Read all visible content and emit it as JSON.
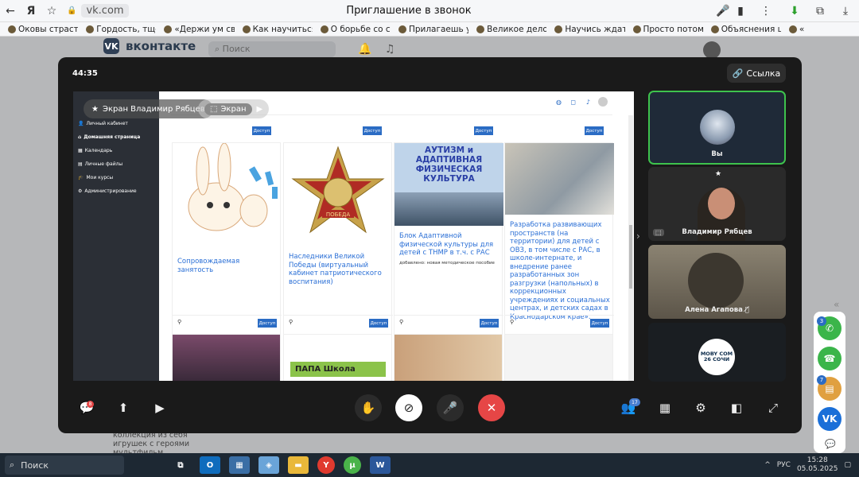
{
  "browser": {
    "url": "vk.com",
    "page_title": "Приглашение в звонок",
    "bookmarks": [
      "Оковы страстей и",
      "Гордость, тщесла",
      "«Держи ум свой",
      "Как научиться до",
      "О борьбе со стра",
      "Прилагаешь усил",
      "Великое дело — у",
      "Научись ждать / I",
      "Просто потому, ч",
      "Объяснения церк",
      "«"
    ]
  },
  "vk": {
    "logo_text": "вконтакте",
    "search_placeholder": "Поиск",
    "bottom_text": "коллекция из себя игрушек с героями мультфильм"
  },
  "call": {
    "timer": "44:35",
    "link_label": "Ссылка",
    "screen_owner_label": "Экран Владимир Рябцев",
    "screen_label": "Экран",
    "participants": [
      {
        "name": "Вы"
      },
      {
        "name": "Владимир Рябцев"
      },
      {
        "name": "Алена Агапова"
      },
      {
        "name": "MOBY COM 26 СОЧИ"
      }
    ],
    "chat_badge": "8",
    "participants_badge": "17"
  },
  "shared_screen": {
    "sidebar": [
      "Личный кабинет",
      "Домашняя страница",
      "Календарь",
      "Личные файлы",
      "Мои курсы",
      "Администрирование"
    ],
    "doc_label": "Доступ",
    "cards": [
      {
        "title": "Сопровождаемая занятость"
      },
      {
        "title": "Наследники Великой Победы (виртуальный кабинет патриотического воспитания)"
      },
      {
        "title": "Блок Адаптивной физической культуры для детей с ТНМР в т.ч. с РАС",
        "image_heading": "АУТИЗМ и АДАПТИВНАЯ ФИЗИЧЕСКАЯ КУЛЬТУРА",
        "note": "добавлено: новая методическое пособие"
      },
      {
        "title": "Разработка развивающих пространств (на территории) для детей с ОВЗ, в том числе с РАС, в школе-интернате, и внедрение ранее разработанных зон разгрузки (напольных) в коррекционных учреждениях и социальных центрах, и детских садах в Краснодарском крае»."
      }
    ],
    "medal_text": "ПОБЕДА",
    "poster_text": "ПАПА Школа"
  },
  "right_panel": {
    "badges": [
      "3",
      "7"
    ]
  },
  "taskbar": {
    "search_label": "Поиск",
    "lang": "РУС",
    "time": "15:28",
    "date": "05.05.2025"
  }
}
